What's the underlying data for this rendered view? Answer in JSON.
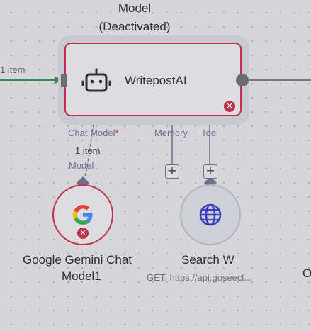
{
  "top_node": {
    "title_line1": "Model",
    "title_line2": "(Deactivated)",
    "name": "WritepostAI",
    "error_icon": "x-circle-icon"
  },
  "input_connection": {
    "label": "1 item",
    "color": "#2e8b57"
  },
  "ports": {
    "chat_model": "Chat Model",
    "required_mark": "*",
    "memory": "Memory",
    "tool": "Tool"
  },
  "link_labels": {
    "count": "1 item",
    "type": "Model"
  },
  "gemini_node": {
    "name_line1": "Google Gemini Chat",
    "name_line2": "Model1",
    "icon": "google-g-icon"
  },
  "search_node": {
    "name": "Search W",
    "subtitle": "GET: https://api.goseecl..."
  },
  "plus_buttons": {
    "memory": "+",
    "tool": "+"
  },
  "partial_right": "O",
  "colors": {
    "error": "#c0334b",
    "port": "#6e6f8e",
    "canvas": "#d6d6d9"
  }
}
